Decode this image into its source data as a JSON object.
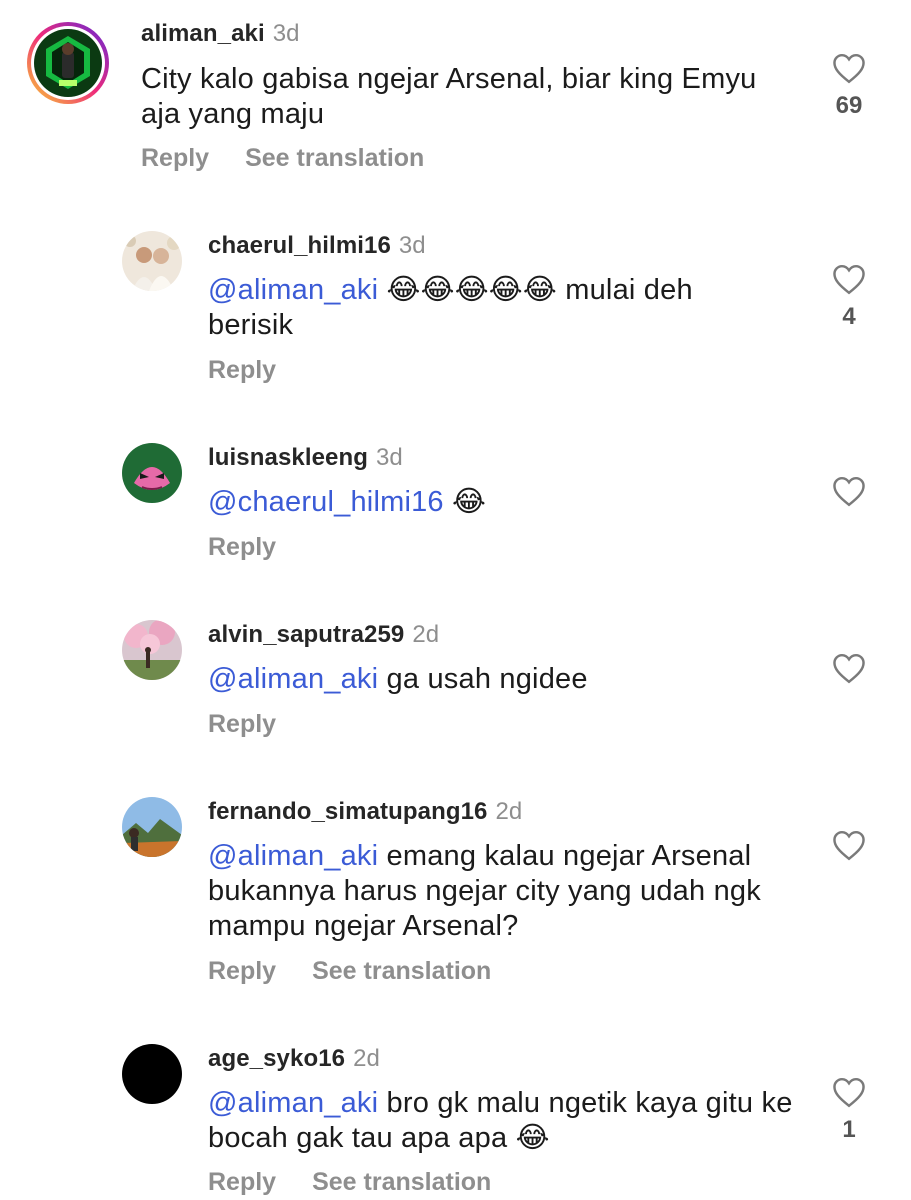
{
  "comments": [
    {
      "username": "aliman_aki",
      "time": "3d",
      "mention": "",
      "text_before": "",
      "text_after": "City kalo gabisa ngejar Arsenal, biar king Emyu aja yang maju",
      "reply": "Reply",
      "translate": "See translation",
      "likes": "69",
      "emoji_count": 0,
      "avatar": "green-hexagon-profile"
    },
    {
      "username": "chaerul_hilmi16",
      "time": "3d",
      "mention": "@aliman_aki",
      "text_after": "mulai deh berisik",
      "emoji": "😂😂😂😂😂",
      "reply": "Reply",
      "translate": "",
      "likes": "4",
      "avatar": "wedding-photo"
    },
    {
      "username": "luisnaskleeng",
      "time": "3d",
      "mention": "@chaerul_hilmi16",
      "text_after": "",
      "emoji": "😂",
      "reply": "Reply",
      "translate": "",
      "likes": "",
      "avatar": "pink-mask-green"
    },
    {
      "username": "alvin_saputra259",
      "time": "2d",
      "mention": "@aliman_aki",
      "text_after": "ga usah ngidee",
      "emoji": "",
      "reply": "Reply",
      "translate": "",
      "likes": "",
      "avatar": "cherry-blossom-park"
    },
    {
      "username": "fernando_simatupang16",
      "time": "2d",
      "mention": "@aliman_aki",
      "text_after": "emang kalau ngejar Arsenal bukannya harus ngejar city yang udah ngk mampu ngejar Arsenal?",
      "emoji": "",
      "reply": "Reply",
      "translate": "See translation",
      "likes": "",
      "avatar": "mountain-landscape"
    },
    {
      "username": "age_syko16",
      "time": "2d",
      "mention": "@aliman_aki",
      "text_after": "bro gk malu ngetik kaya gitu ke bocah gak tau apa apa",
      "emoji": "😂",
      "reply": "Reply",
      "translate": "See translation",
      "likes": "1",
      "avatar": "black-circle"
    }
  ],
  "colors": {
    "mention": "#3b5bd6",
    "meta_gray": "#8e8e8e",
    "ring_gradient": [
      "#f9ce34",
      "#ee2a7b",
      "#6228d7"
    ]
  },
  "icons": {
    "like": "heart-outline-icon",
    "threads": "threads-at-icon"
  }
}
